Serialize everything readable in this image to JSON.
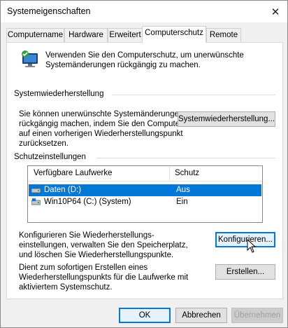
{
  "window": {
    "title": "Systemeigenschaften",
    "close_glyph": "✕"
  },
  "tabs": [
    {
      "label": "Computername"
    },
    {
      "label": "Hardware"
    },
    {
      "label": "Erweitert"
    },
    {
      "label": "Computerschutz",
      "active": true
    },
    {
      "label": "Remote"
    }
  ],
  "intro": {
    "icon": "system-protection-icon",
    "text": "Verwenden Sie den Computerschutz, um unerwünschte Systemänderungen rückgängig zu machen."
  },
  "restore": {
    "heading": "Systemwiederherstellung",
    "description": "Sie können unerwünschte Systemänderungen rückgängig machen, indem Sie den Computer auf einen vorherigen Wiederherstellungspunkt zurücksetzen.",
    "button_label": "Systemwiederherstellung..."
  },
  "protection": {
    "heading": "Schutzeinstellungen",
    "columns": [
      "Verfügbare Laufwerke",
      "Schutz"
    ],
    "drives": [
      {
        "name": "Daten (D:)",
        "protection": "Aus",
        "selected": true,
        "icon": "drive-icon"
      },
      {
        "name": "Win10P64 (C:) (System)",
        "protection": "Ein",
        "selected": false,
        "icon": "system-drive-icon"
      }
    ],
    "configure_text": "Konfigurieren Sie Wiederherstellungs-einstellungen, verwalten Sie den Speicherplatz, und löschen Sie Wiederherstellungspunkte.",
    "configure_button": "Konfigurieren...",
    "create_text": "Dient zum sofortigen Erstellen eines Wiederherstellungspunkts für die Laufwerke mit aktiviertem Systemschutz.",
    "create_button": "Erstellen..."
  },
  "footer": {
    "ok": "OK",
    "cancel": "Abbrechen",
    "apply": "Übernehmen"
  },
  "colors": {
    "selection": "#0078d7",
    "window_bg": "#f0f0f0",
    "panel_bg": "#ffffff"
  }
}
